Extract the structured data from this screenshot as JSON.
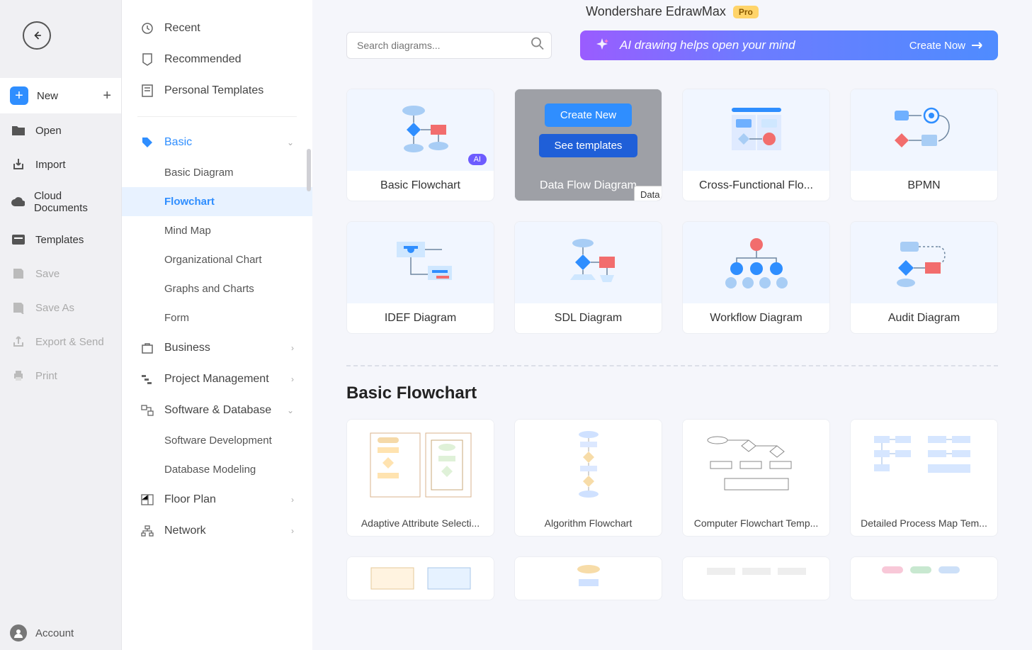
{
  "header": {
    "title": "Wondershare EdrawMax",
    "pro_label": "Pro"
  },
  "search": {
    "placeholder": "Search diagrams..."
  },
  "ai_banner": {
    "text": "AI drawing helps open your mind",
    "cta": "Create Now"
  },
  "nav": {
    "back": "←",
    "items": [
      {
        "label": "New",
        "disabled": false,
        "new_style": true,
        "plus": true
      },
      {
        "label": "Open",
        "disabled": false
      },
      {
        "label": "Import",
        "disabled": false
      },
      {
        "label": "Cloud Documents",
        "disabled": false
      },
      {
        "label": "Templates",
        "disabled": false
      },
      {
        "label": "Save",
        "disabled": true
      },
      {
        "label": "Save As",
        "disabled": true
      },
      {
        "label": "Export & Send",
        "disabled": true
      },
      {
        "label": "Print",
        "disabled": true
      }
    ],
    "account": "Account"
  },
  "categories": {
    "top": [
      {
        "label": "Recent"
      },
      {
        "label": "Recommended"
      },
      {
        "label": "Personal Templates"
      }
    ],
    "basic": {
      "label": "Basic",
      "subs": [
        {
          "label": "Basic Diagram"
        },
        {
          "label": "Flowchart",
          "active": true
        },
        {
          "label": "Mind Map"
        },
        {
          "label": "Organizational Chart"
        },
        {
          "label": "Graphs and Charts"
        },
        {
          "label": "Form"
        }
      ]
    },
    "others": [
      {
        "label": "Business"
      },
      {
        "label": "Project Management"
      },
      {
        "label": "Software & Database",
        "expanded": true,
        "subs": [
          {
            "label": "Software Development"
          },
          {
            "label": "Database Modeling"
          }
        ]
      },
      {
        "label": "Floor Plan"
      },
      {
        "label": "Network"
      }
    ]
  },
  "type_cards": [
    {
      "label": "Basic Flowchart",
      "ai": true
    },
    {
      "label": "Data Flow Diagram",
      "hovered": true,
      "create": "Create New",
      "see": "See templates",
      "tooltip": "Data Flow Diagram"
    },
    {
      "label": "Cross-Functional Flo..."
    },
    {
      "label": "BPMN"
    },
    {
      "label": "IDEF Diagram"
    },
    {
      "label": "SDL Diagram"
    },
    {
      "label": "Workflow Diagram"
    },
    {
      "label": "Audit Diagram"
    }
  ],
  "section_title": "Basic Flowchart",
  "templates": [
    {
      "label": "Adaptive Attribute Selecti..."
    },
    {
      "label": "Algorithm Flowchart"
    },
    {
      "label": "Computer Flowchart Temp..."
    },
    {
      "label": "Detailed Process Map Tem..."
    }
  ]
}
